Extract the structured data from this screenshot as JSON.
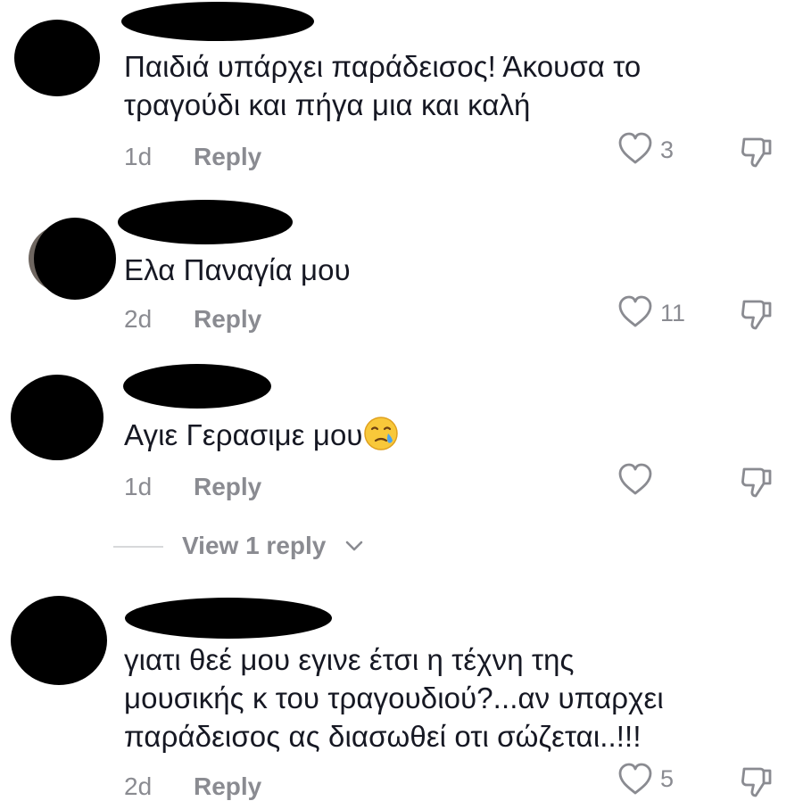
{
  "comments": [
    {
      "text_lines": [
        "Παιδιά υπάρχει παράδεισος! Άκουσα το",
        "τραγούδι και πήγα μια και καλή"
      ],
      "time": "1d",
      "reply_label": "Reply",
      "likes": "3"
    },
    {
      "text_lines": [
        "Ελα Παναγία μου"
      ],
      "time": "2d",
      "reply_label": "Reply",
      "likes": "11"
    },
    {
      "text_lines": [
        "Αγιε Γερασιμε μου"
      ],
      "emoji": "crying-face",
      "time": "1d",
      "reply_label": "Reply",
      "likes": ""
    },
    {
      "text_lines": [
        "γιατι θεέ μου εγινε έτσι η τέχνη της",
        "μουσικής κ του τραγουδιού?...αν υπαρχει",
        "παράδεισος ας διασωθεί οτι σώζεται..!!!"
      ],
      "time": "2d",
      "reply_label": "Reply",
      "likes": "5"
    }
  ],
  "view_replies": {
    "label": "View 1 reply"
  },
  "icons": {
    "like": "heart-outline-icon",
    "dislike": "thumbs-down-outline-icon",
    "chevron": "chevron-down-icon"
  },
  "colors": {
    "text": "#161823",
    "muted": "#8a8b91",
    "redaction": "#000000",
    "divider": "#d7d8da"
  }
}
